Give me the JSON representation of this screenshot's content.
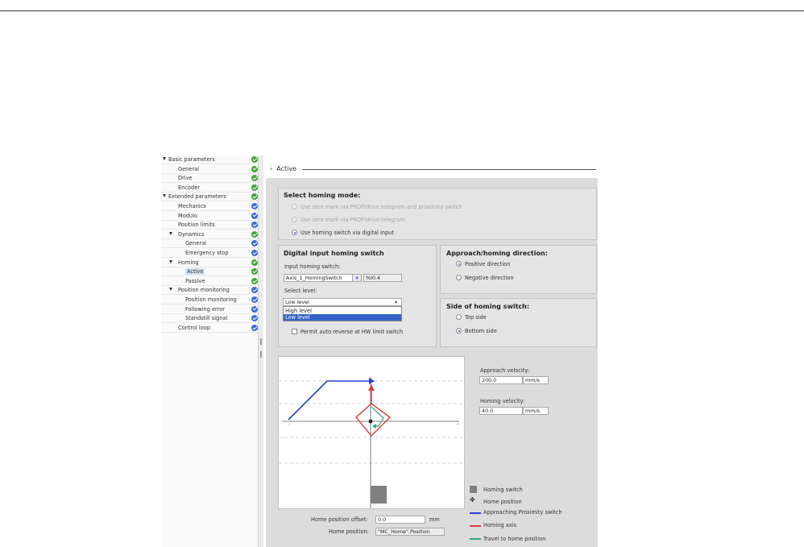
{
  "nav": {
    "items": [
      {
        "label": "Basic parameters",
        "level": 0,
        "expanded": true,
        "status": "green"
      },
      {
        "label": "General",
        "level": 1,
        "status": "green"
      },
      {
        "label": "Drive",
        "level": 1,
        "status": "green"
      },
      {
        "label": "Encoder",
        "level": 1,
        "status": "green"
      },
      {
        "label": "Extended parameters",
        "level": 0,
        "expanded": true,
        "status": "green"
      },
      {
        "label": "Mechanics",
        "level": 1,
        "status": "blue"
      },
      {
        "label": "Modulo",
        "level": 1,
        "status": "blue"
      },
      {
        "label": "Position limits",
        "level": 1,
        "status": "blue"
      },
      {
        "label": "Dynamics",
        "level": 1,
        "expanded": true,
        "status": "green"
      },
      {
        "label": "General",
        "level": 2,
        "status": "blue"
      },
      {
        "label": "Emergency stop",
        "level": 2,
        "status": "blue"
      },
      {
        "label": "Homing",
        "level": 1,
        "expanded": true,
        "status": "green"
      },
      {
        "label": "Active",
        "level": 2,
        "selected": true,
        "status": "green"
      },
      {
        "label": "Passive",
        "level": 2,
        "status": "green"
      },
      {
        "label": "Position monitoring",
        "level": 1,
        "expanded": true,
        "status": "blue"
      },
      {
        "label": "Position monitoring",
        "level": 2,
        "status": "blue"
      },
      {
        "label": "Following error",
        "level": 2,
        "status": "blue"
      },
      {
        "label": "Standstill signal",
        "level": 2,
        "status": "blue"
      },
      {
        "label": "Control loop",
        "level": 1,
        "status": "blue"
      }
    ]
  },
  "section": {
    "arrow": "›",
    "title": "Active"
  },
  "homing_mode": {
    "title": "Select homing mode:",
    "options": [
      {
        "label": "Use zero mark via PROFIdrive telegram and proximity switch",
        "enabled": false,
        "checked": false
      },
      {
        "label": "Use zero mark via PROFIdrive telegram",
        "enabled": false,
        "checked": false
      },
      {
        "label": "Use homing switch via digital input",
        "enabled": true,
        "checked": true
      }
    ]
  },
  "digital_input": {
    "title": "Digital input homing switch",
    "input_label": "Input homing switch:",
    "input_value": "Axis_1_HomingSwitch",
    "input_button": "▾",
    "address": "%I0.4",
    "level_label": "Select level:",
    "level_value": "Low level",
    "level_options": [
      "High level",
      "Low level"
    ],
    "level_selected_index": 1,
    "auto_reverse_label": "Permit auto reverse at HW limit switch",
    "auto_reverse_checked": false
  },
  "direction": {
    "title": "Approach/homing direction:",
    "options": [
      {
        "label": "Positive direction",
        "checked": true
      },
      {
        "label": "Negative direction",
        "checked": false
      }
    ]
  },
  "side": {
    "title": "Side of homing switch:",
    "options": [
      {
        "label": "Top side",
        "checked": false
      },
      {
        "label": "Bottom side",
        "checked": true
      }
    ]
  },
  "velocities": {
    "approach_label": "Approach velocity:",
    "approach_value": "200.0",
    "homing_label": "Homing velocity:",
    "homing_value": "40.0",
    "unit": "mm/s"
  },
  "home_offset": {
    "label": "Home position offset:",
    "value": "0.0",
    "unit": "mm"
  },
  "home_position": {
    "label": "Home position:",
    "value": "\"MC_Home\".Position"
  },
  "legend": {
    "items": [
      {
        "label": "Homing switch",
        "icon": "gray-square",
        "color": "#808080"
      },
      {
        "label": "Home position",
        "icon": "home-position-icon",
        "color": "#222222"
      },
      {
        "label": "Approaching Proximity switch",
        "icon": "line",
        "color": "#2b3bd6"
      },
      {
        "label": "Homing axis",
        "icon": "line",
        "color": "#e03a3a"
      },
      {
        "label": "Travel to home position",
        "icon": "line",
        "color": "#2fa580"
      }
    ]
  },
  "colors": {
    "approach": "#2b3bd6",
    "homing": "#e03a3a",
    "travel": "#2fa580",
    "switch": "#808080",
    "ok": "#3fa535",
    "info": "#3d6ad6"
  }
}
